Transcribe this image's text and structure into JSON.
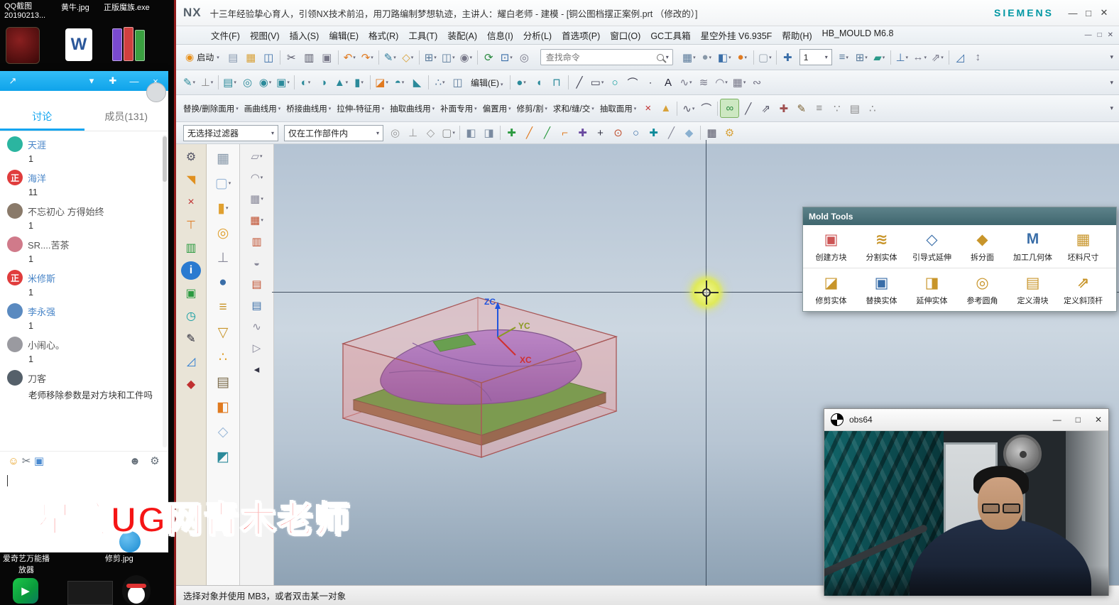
{
  "window_controls": {
    "min": "—",
    "max": "□",
    "close": "✕"
  },
  "watermark": "星航UG网青木老师",
  "desktop": {
    "icons": [
      "QQ截图\n20190213...",
      "黄牛.jpg",
      "正版魔族.exe"
    ],
    "bottom_labels": [
      "爱奇艺万能播",
      "修剪.jpg",
      "放器"
    ],
    "word_glyph": "W",
    "play_glyph": "▶"
  },
  "qq": {
    "header_left": [
      {
        "n": "share-icon",
        "g": "↗",
        "c": "#ffffff"
      }
    ],
    "header_right": [
      {
        "n": "chevron-down-icon",
        "g": "▾",
        "c": "#ffffff"
      },
      {
        "n": "pin-icon",
        "g": "✚",
        "c": "#ffffff"
      },
      {
        "n": "minimize-icon",
        "g": "—",
        "c": "#ffffff"
      },
      {
        "n": "close-icon",
        "g": "×",
        "c": "#ffffff"
      }
    ],
    "tabs": [
      {
        "label": "讨论",
        "active": true
      },
      {
        "label": "成员(131)"
      }
    ],
    "members": [
      {
        "name": "天涯",
        "detail": "1",
        "avatar_color": "#2bb5a0",
        "name_color": "#4a86c8"
      },
      {
        "name": "海洋",
        "detail": "11",
        "badge": "正",
        "avatar_color": "#e03c3c",
        "name_color": "#4a86c8"
      },
      {
        "name": "不忘初心 方得始终",
        "detail": "1",
        "avatar_color": "#8a7a6a",
        "name_color": "#555555"
      },
      {
        "name": "SR....苦茶",
        "detail": "1",
        "avatar_color": "#d07a8a",
        "name_color": "#555555"
      },
      {
        "name": "米修斯",
        "detail": "1",
        "badge": "正",
        "avatar_color": "#e03c3c",
        "name_color": "#4a86c8"
      },
      {
        "name": "李永强",
        "detail": "1",
        "avatar_color": "#5a8ac0",
        "name_color": "#4a86c8"
      },
      {
        "name": "小闹心。",
        "detail": "1",
        "avatar_color": "#9a9aa0",
        "name_color": "#555555"
      },
      {
        "name": "刀客",
        "detail": "老师移除参数是对方块和工件吗",
        "avatar_color": "#55606a",
        "name_color": "#555555"
      }
    ],
    "tool_icons": [
      {
        "n": "emoji-icon",
        "g": "☺",
        "c": "#e8a020"
      },
      {
        "n": "screenshot-scissors-icon",
        "g": "✂",
        "c": "#66707a"
      },
      {
        "n": "image-icon",
        "g": "▣",
        "c": "#4a8ad0"
      }
    ],
    "tool_icons_right": [
      {
        "n": "add-member-icon",
        "g": "☻",
        "c": "#66707a"
      },
      {
        "n": "settings-gear-icon",
        "g": "⚙",
        "c": "#66707a"
      }
    ]
  },
  "nx": {
    "logo": "NX",
    "brand": "SIEMENS",
    "title": "十三年经验挚心育人，引领NX技术前沿，用刀路编制梦想轨迹，主讲人：耀白老师 - 建模 - [铜公图档摆正案例.prt （修改的）]",
    "menus": [
      "文件(F)",
      "视图(V)",
      "插入(S)",
      "编辑(E)",
      "格式(R)",
      "工具(T)",
      "装配(A)",
      "信息(I)",
      "分析(L)",
      "首选项(P)",
      "窗口(O)",
      "GC工具箱",
      "星空外挂 V6.935F",
      "帮助(H)",
      "HB_MOULD M6.8"
    ],
    "start_label": "启动",
    "edit_label": "编辑(E)",
    "search_placeholder": "查找命令",
    "zoom_value": "1",
    "filter_value": "无选择过滤器",
    "scope_value": "仅在工作部件内",
    "group_labels": [
      "替换/删除面用",
      "画曲线用",
      "桥接曲线用",
      "拉伸-特征用",
      "抽取曲线用",
      "补面专用",
      "偏置用",
      "修剪/割",
      "求和/缝/交",
      "抽取面用"
    ],
    "status": "选择对象并使用 MB3，或者双击某一对象",
    "axes": {
      "z": "ZC",
      "y": "YC",
      "x": "XC"
    }
  },
  "icons": {
    "toolbarA": [
      {
        "n": "new-file-icon",
        "g": "▤",
        "c": "#8a9ab0"
      },
      {
        "n": "open-folder-icon",
        "g": "▦",
        "c": "#d8a23a"
      },
      {
        "n": "save-icon",
        "g": "◫",
        "c": "#3a6ea8"
      },
      {
        "sep": true
      },
      {
        "n": "cut-scissors-icon",
        "g": "✂",
        "c": "#556"
      },
      {
        "n": "copy-icon",
        "g": "▥",
        "c": "#556"
      },
      {
        "n": "paste-icon",
        "g": "▣",
        "c": "#778"
      },
      {
        "sep": true
      },
      {
        "n": "undo-icon",
        "g": "↶",
        "c": "#e07a20",
        "cr": true
      },
      {
        "n": "redo-icon",
        "g": "↷",
        "c": "#e07a20",
        "cr": true
      },
      {
        "sep": true
      },
      {
        "n": "sketch-icon",
        "g": "✎",
        "c": "#2b7a9a",
        "cr": true
      },
      {
        "n": "datum-plane-icon",
        "g": "◇",
        "c": "#d8a23a",
        "cr": true
      },
      {
        "sep": true
      },
      {
        "n": "view-section-icon",
        "g": "⊞",
        "c": "#5a7a9a",
        "cr": true
      },
      {
        "n": "named-view-icon",
        "g": "◫",
        "c": "#5a7a9a",
        "cr": true
      },
      {
        "n": "snapshot-icon",
        "g": "◉",
        "c": "#778",
        "cr": true
      },
      {
        "sep": true
      },
      {
        "n": "refresh-icon",
        "g": "⟳",
        "c": "#2b8a40"
      },
      {
        "n": "fit-view-icon",
        "g": "⊡",
        "c": "#3a6ea8",
        "cr": true
      },
      {
        "n": "zoom-lens-icon",
        "g": "◎",
        "c": "#778"
      }
    ],
    "toolbarA2pre": [
      {
        "n": "layout-grid-icon",
        "g": "▦",
        "c": "#5a7a9a",
        "cr": true
      },
      {
        "n": "shaded-sphere-icon",
        "g": "●",
        "c": "#8898a8",
        "cr": true
      },
      {
        "n": "orient-cube-icon",
        "g": "◧",
        "c": "#3a6ea8",
        "cr": true
      },
      {
        "n": "render-ball-icon",
        "g": "●",
        "c": "#e07a20",
        "cr": true
      },
      {
        "sep": true
      },
      {
        "n": "window-icon",
        "g": "▢",
        "c": "#98a4b0",
        "cr": true
      },
      {
        "sep": true
      },
      {
        "n": "pan-icon",
        "g": "✚",
        "c": "#3a6ea8"
      }
    ],
    "toolbarA2post": [
      {
        "n": "layer-settings-icon",
        "g": "≡",
        "c": "#5a7a9a",
        "cr": true
      },
      {
        "n": "layer-category-icon",
        "g": "⊞",
        "c": "#5a7a9a",
        "cr": true
      },
      {
        "n": "object-display-icon",
        "g": "▰",
        "c": "#2b9a8a",
        "cr": true
      },
      {
        "sep": true
      },
      {
        "n": "measure-icon",
        "g": "⊥",
        "c": "#3a6ea8",
        "cr": true
      },
      {
        "n": "distance-icon",
        "g": "↔",
        "c": "#778",
        "cr": true
      },
      {
        "n": "extend-icon",
        "g": "⇗",
        "c": "#778",
        "cr": true
      },
      {
        "sep": true
      },
      {
        "n": "ruler-icon",
        "g": "◿",
        "c": "#3a6ea8"
      },
      {
        "n": "arrows-cross-icon",
        "g": "↕",
        "c": "#778"
      }
    ],
    "toolbarB1": [
      {
        "n": "direct-sketch-icon",
        "g": "✎",
        "c": "#2b8a9a",
        "cr": true
      },
      {
        "n": "datum-csys-icon",
        "g": "⊥",
        "c": "#888",
        "cr": true
      },
      {
        "sep": true
      },
      {
        "n": "extrude-icon",
        "g": "▤",
        "c": "#2b8a9a",
        "cr": true
      },
      {
        "n": "revolve-icon",
        "g": "◎",
        "c": "#2b8a9a"
      },
      {
        "n": "hole-icon",
        "g": "◉",
        "c": "#2b8a9a",
        "cr": true
      },
      {
        "n": "block-icon",
        "g": "▣",
        "c": "#2b8a9a",
        "cr": true
      },
      {
        "sep": true
      },
      {
        "n": "unite-icon",
        "g": "◐",
        "c": "#2b8a9a",
        "cr": true
      },
      {
        "n": "subtract-icon",
        "g": "◑",
        "c": "#2b8a9a"
      },
      {
        "n": "cone-icon",
        "g": "▲",
        "c": "#2b8a9a",
        "cr": true
      },
      {
        "n": "cylinder-icon",
        "g": "▮",
        "c": "#2b8a9a",
        "cr": true
      },
      {
        "sep": true
      },
      {
        "n": "trim-body-icon",
        "g": "◪",
        "c": "#e07a20",
        "cr": true
      },
      {
        "n": "edge-blend-icon",
        "g": "◓",
        "c": "#2b8a9a",
        "cr": true
      },
      {
        "n": "chamfer-icon",
        "g": "◣",
        "c": "#2b8a9a"
      },
      {
        "sep": true
      },
      {
        "n": "pattern-icon",
        "g": "∴",
        "c": "#5a7a9a",
        "cr": true
      },
      {
        "n": "mirror-icon",
        "g": "◫",
        "c": "#5a7a9a"
      }
    ],
    "toolbarB2": [
      {
        "sep": true
      },
      {
        "n": "sphere-icon",
        "g": "●",
        "c": "#2b8a9a",
        "cr": true
      },
      {
        "n": "tube-icon",
        "g": "◖",
        "c": "#2b8a9a"
      },
      {
        "n": "rib-icon",
        "g": "⊓",
        "c": "#2b8a9a"
      },
      {
        "sep": true
      },
      {
        "n": "line-icon",
        "g": "╱",
        "c": "#445"
      },
      {
        "n": "rectangle-icon",
        "g": "▭",
        "c": "#445",
        "cr": true
      },
      {
        "n": "circle-icon",
        "g": "○",
        "c": "#0a9a9a"
      },
      {
        "n": "arc-icon",
        "g": "⌒",
        "c": "#445"
      },
      {
        "n": "point-icon",
        "g": "∙",
        "c": "#445"
      },
      {
        "n": "text-tool-icon",
        "g": "A",
        "c": "#223"
      },
      {
        "n": "spline-icon",
        "g": "∿",
        "c": "#778",
        "cr": true
      },
      {
        "n": "helix-icon",
        "g": "≋",
        "c": "#778"
      },
      {
        "n": "surface-icon",
        "g": "◠",
        "c": "#778",
        "cr": true
      },
      {
        "n": "mesh-icon",
        "g": "▦",
        "c": "#778",
        "cr": true
      },
      {
        "n": "sew-icon",
        "g": "∾",
        "c": "#778"
      }
    ],
    "toolbarC": [
      {
        "n": "delete-face-icon",
        "g": "×",
        "c": "#c03030"
      },
      {
        "n": "cone-tip-icon",
        "g": "▲",
        "c": "#d8a23a"
      },
      {
        "sep": true
      },
      {
        "n": "studio-spline-icon",
        "g": "∿",
        "c": "#556",
        "cr": true
      },
      {
        "n": "bridge-curve-icon",
        "g": "⌒",
        "c": "#556"
      },
      {
        "sep": true
      },
      {
        "n": "wave-link-icon",
        "g": "∞",
        "c": "#2b8a40",
        "hl": true
      },
      {
        "n": "line-angled-icon",
        "g": "╱",
        "c": "#556"
      },
      {
        "n": "diagonal-arrow-icon",
        "g": "⇗",
        "c": "#556"
      },
      {
        "n": "cross-plus-icon",
        "g": "✚",
        "c": "#a05050"
      },
      {
        "n": "curve-pencil-icon",
        "g": "✎",
        "c": "#7a6030"
      },
      {
        "n": "offset-curve-icon",
        "g": "≡",
        "c": "#888"
      },
      {
        "n": "points-set-icon",
        "g": "∵",
        "c": "#888"
      },
      {
        "n": "pencil-grid-icon",
        "g": "▤",
        "c": "#888"
      },
      {
        "n": "dots-icon",
        "g": "∴",
        "c": "#888"
      }
    ],
    "toolbarD": [
      {
        "n": "snap-end-icon",
        "g": "◎",
        "c": "#999"
      },
      {
        "n": "snap-mid-icon",
        "g": "⊥",
        "c": "#999"
      },
      {
        "n": "snap-star-icon",
        "g": "◇",
        "c": "#999"
      },
      {
        "n": "lasso-icon",
        "g": "▢",
        "c": "#888",
        "cr": true
      },
      {
        "sep": true
      },
      {
        "n": "solid-cube-icon",
        "g": "◧",
        "c": "#7a8aa0"
      },
      {
        "n": "facet-cube-icon",
        "g": "◨",
        "c": "#7a8aa0"
      },
      {
        "sep": true
      },
      {
        "n": "move-cross-icon",
        "g": "✚",
        "c": "#2b9a40"
      },
      {
        "n": "slash-orange-icon",
        "g": "╱",
        "c": "#e07a20"
      },
      {
        "n": "slash-green-icon",
        "g": "╱",
        "c": "#2b9a40"
      },
      {
        "n": "hook-icon",
        "g": "⌐",
        "c": "#e07a20"
      },
      {
        "n": "snap-violet-icon",
        "g": "✚",
        "c": "#6a4aa0"
      },
      {
        "n": "snap-plus-icon",
        "g": "+",
        "c": "#334"
      },
      {
        "n": "snap-center-icon",
        "g": "⊙",
        "c": "#c05030"
      },
      {
        "n": "snap-circle-icon",
        "g": "○",
        "c": "#3a6ea8"
      },
      {
        "n": "snap-cross-icon",
        "g": "✚",
        "c": "#0a8a9a"
      },
      {
        "n": "snap-slash-icon",
        "g": "╱",
        "c": "#889"
      },
      {
        "n": "gem-icon",
        "g": "◆",
        "c": "#8ab0d0"
      },
      {
        "sep": true
      },
      {
        "n": "grid-table-icon",
        "g": "▦",
        "c": "#556"
      },
      {
        "n": "wrench-icon",
        "g": "⚙",
        "c": "#d8a23a"
      }
    ],
    "strip": [
      {
        "n": "gear-icon",
        "g": "⚙",
        "c": "#556"
      },
      {
        "n": "roadmap-icon",
        "g": "◥",
        "c": "#e09020"
      },
      {
        "n": "transform-icon",
        "g": "×",
        "c": "#c03030"
      },
      {
        "n": "tsquare-icon",
        "g": "⊤",
        "c": "#e07a20"
      },
      {
        "n": "bar-chart-icon",
        "g": "▥",
        "c": "#2b9a40"
      },
      {
        "n": "info-icon",
        "g": "i",
        "c": "#ffffff",
        "bg": "#2a7ad0"
      },
      {
        "n": "green-tile-icon",
        "g": "▣",
        "c": "#2b9a40"
      },
      {
        "n": "clock-icon",
        "g": "◷",
        "c": "#0a9aa0"
      },
      {
        "n": "pen-icon",
        "g": "✎",
        "c": "#223"
      },
      {
        "n": "ruler-triangle-icon",
        "g": "◿",
        "c": "#2a7ad0"
      },
      {
        "n": "red-tool-icon",
        "g": "◆",
        "c": "#c03030"
      }
    ],
    "col2": [
      {
        "n": "sheet-grid-icon",
        "g": "▦",
        "c": "#8899aa"
      },
      {
        "n": "glass-box-icon",
        "g": "▢",
        "c": "#9ab8d8",
        "cr": true
      },
      {
        "n": "orange-cylinder-icon",
        "g": "▮",
        "c": "#e0a030",
        "cr": true
      },
      {
        "n": "coil-ring-icon",
        "g": "◎",
        "c": "#e0a030"
      },
      {
        "n": "t-fixture-icon",
        "g": "⊥",
        "c": "#889"
      },
      {
        "n": "blue-sphere-icon",
        "g": "●",
        "c": "#3a6ea8"
      },
      {
        "n": "gold-stack-icon",
        "g": "≡",
        "c": "#c8952a"
      },
      {
        "n": "funnel-icon",
        "g": "▽",
        "c": "#c8952a"
      },
      {
        "n": "gold-dots-icon",
        "g": "∴",
        "c": "#e0a030"
      },
      {
        "n": "map-book-icon",
        "g": "▤",
        "c": "#7a6a4a"
      },
      {
        "n": "orange-box-icon",
        "g": "◧",
        "c": "#e07a20"
      },
      {
        "n": "glass-gem-icon",
        "g": "◇",
        "c": "#9ab8d8"
      },
      {
        "n": "teal-cube-icon",
        "g": "◩",
        "c": "#2b8a9a"
      }
    ],
    "col3": [
      {
        "n": "four-plane-icon",
        "g": "▱",
        "c": "#889",
        "cr": true
      },
      {
        "n": "ruled-surface-icon",
        "g": "◠",
        "c": "#889",
        "cr": true
      },
      {
        "n": "mesh-surface-icon",
        "g": "▦",
        "c": "#889",
        "cr": true
      },
      {
        "n": "red-mesh-icon",
        "g": "▦",
        "c": "#c05030",
        "cr": true
      },
      {
        "n": "red-grid-icon",
        "g": "▥",
        "c": "#c05030"
      },
      {
        "n": "sphere-mesh-icon",
        "g": "◒",
        "c": "#889"
      },
      {
        "n": "red-pages-icon",
        "g": "▤",
        "c": "#c05030"
      },
      {
        "n": "blue-pages-icon",
        "g": "▤",
        "c": "#3a6ea8"
      },
      {
        "n": "swept-icon",
        "g": "∿",
        "c": "#889"
      },
      {
        "n": "bounded-plane-icon",
        "g": "▷",
        "c": "#889"
      },
      {
        "n": "scroll-left-icon",
        "g": "◂",
        "c": "#334"
      }
    ]
  },
  "mold_tools": {
    "title": "Mold Tools",
    "row1": [
      {
        "label": "创建方块",
        "g": "▣",
        "c": "#cc5555"
      },
      {
        "label": "分割实体",
        "g": "≋",
        "c": "#c8952a"
      },
      {
        "label": "引导式延伸",
        "g": "◇",
        "c": "#3a6ea8"
      },
      {
        "label": "拆分面",
        "g": "◆",
        "c": "#c8952a"
      },
      {
        "label": "加工几何体",
        "g": "M",
        "c": "#3a6ea8"
      },
      {
        "label": "坯料尺寸",
        "g": "▦",
        "c": "#c8952a"
      }
    ],
    "row2": [
      {
        "label": "修剪实体",
        "g": "◪",
        "c": "#c8952a"
      },
      {
        "label": "替换实体",
        "g": "▣",
        "c": "#3a6ea8"
      },
      {
        "label": "延伸实体",
        "g": "◨",
        "c": "#c8952a"
      },
      {
        "label": "参考圆角",
        "g": "◎",
        "c": "#c8952a"
      },
      {
        "label": "定义滑块",
        "g": "▤",
        "c": "#c8952a"
      },
      {
        "label": "定义斜顶杆",
        "g": "⇗",
        "c": "#c8952a"
      }
    ]
  },
  "obs": {
    "title": "obs64"
  }
}
